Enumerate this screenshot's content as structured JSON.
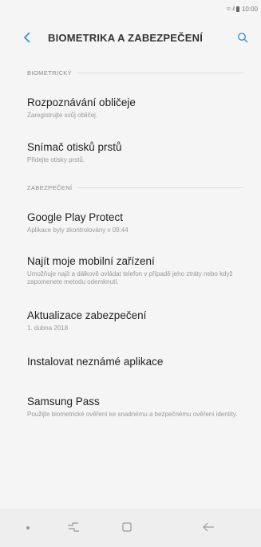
{
  "status_bar": {
    "signal_text": "⁉′.∥",
    "time": "10:00"
  },
  "header": {
    "title": "BIOMETRIKA A ZABEZPEČENÍ",
    "back_icon": "chevron-left-icon",
    "search_icon": "search-icon"
  },
  "sections": [
    {
      "header": "BIOMETRICKÝ",
      "items": [
        {
          "title": "Rozpoznávání obličeje",
          "desc": "Zaregistrujte svůj obličej."
        },
        {
          "title": "Snímač otisků prstů",
          "desc": "Přidejte otisky prstů."
        }
      ]
    },
    {
      "header": "ZABEZPEČENÍ",
      "items": [
        {
          "title": "Google Play Protect",
          "desc": "Aplikace byly zkontrolovány v 09:44"
        },
        {
          "title": "Najít moje mobilní zařízení",
          "desc": "Umožňuje najít a dálkově ovládat telefon v případě jeho ztráty nebo když zapomenete metodu odemknutí."
        },
        {
          "title": "Aktualizace zabezpečení",
          "desc": "1. dubna 2018"
        },
        {
          "title": "Instalovat neznámé aplikace",
          "desc": ""
        },
        {
          "title": "Samsung Pass",
          "desc": "Použijte biometrické ověření ke snadnému a bezpečnému ověření identity."
        }
      ]
    }
  ],
  "nav_bar": {
    "icons": [
      "dot-icon",
      "recent-apps-icon",
      "home-icon",
      "back-arrow-icon"
    ]
  }
}
